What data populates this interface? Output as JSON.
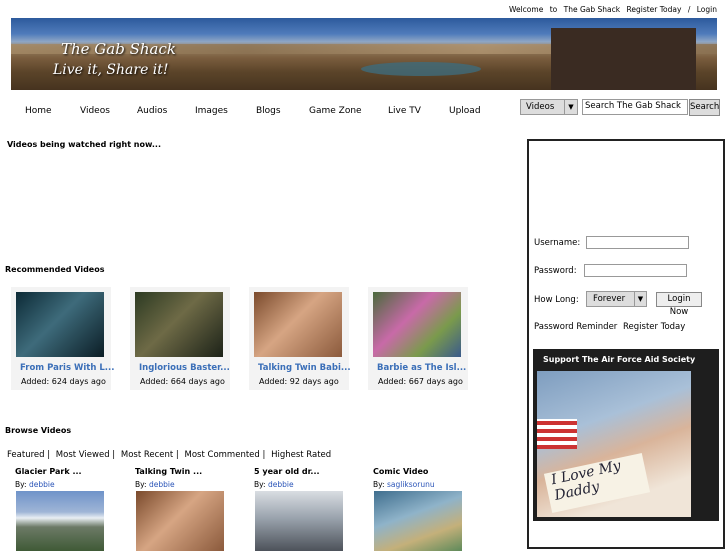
{
  "topbar": {
    "welcome": "Welcome",
    "to": "to",
    "site": "The Gab Shack",
    "register": "Register Today",
    "sep": "/",
    "login": "Login"
  },
  "banner": {
    "line1": "The Gab Shack",
    "line2": "Live it, Share it!"
  },
  "nav": [
    "Home",
    "Videos",
    "Audios",
    "Images",
    "Blogs",
    "Game Zone",
    "Live TV",
    "Upload"
  ],
  "search": {
    "category": "Videos",
    "placeholder": "Search The Gab Shack",
    "button": "Search"
  },
  "watching_heading": "Videos being watched right now...",
  "recommended_heading": "Recommended Videos",
  "recommended": [
    {
      "title": "From Paris With L...",
      "added": "Added: 624 days ago"
    },
    {
      "title": "Inglorious Baster...",
      "added": "Added: 664 days ago"
    },
    {
      "title": "Talking Twin Babi...",
      "added": "Added: 92 days ago"
    },
    {
      "title": "Barbie as The Isl...",
      "added": "Added: 667 days ago"
    }
  ],
  "browse_heading": "Browse Videos",
  "browse_tabs": [
    "Featured |",
    "Most Viewed |",
    "Most Recent |",
    "Most Commented |",
    "Highest Rated"
  ],
  "browse": [
    {
      "title": "Glacier Park ...",
      "by": "By:",
      "user": "debbie"
    },
    {
      "title": "Talking Twin ...",
      "by": "By:",
      "user": "debbie"
    },
    {
      "title": "5 year old dr...",
      "by": "By:",
      "user": "debbie"
    },
    {
      "title": "Comic Video",
      "by": "By:",
      "user": "sagliksorunu"
    }
  ],
  "login": {
    "username_label": "Username:",
    "password_label": "Password:",
    "howlong_label": "How Long:",
    "howlong_value": "Forever",
    "login_button": "Login Now",
    "password_reminder": "Password Reminder",
    "register": "Register Today"
  },
  "promo": {
    "title": "Support The Air Force Aid Society",
    "sign_text": "I Love My Daddy"
  }
}
